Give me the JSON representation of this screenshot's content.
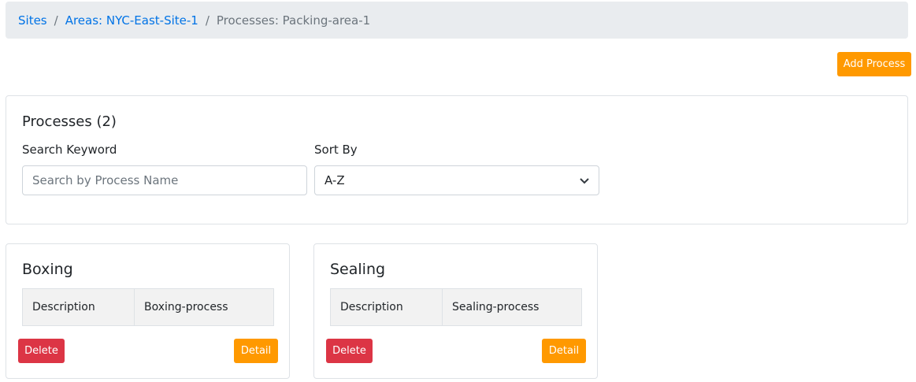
{
  "breadcrumb": {
    "items": [
      "Sites",
      "Areas: NYC-East-Site-1"
    ],
    "current": "Processes: Packing-area-1",
    "separator": "/"
  },
  "toolbar": {
    "add_label": "Add Process"
  },
  "filters": {
    "title": "Processes (2)",
    "search_label": "Search Keyword",
    "search_placeholder": "Search by Process Name",
    "search_value": "",
    "sort_label": "Sort By",
    "sort_value": "A-Z"
  },
  "processes": [
    {
      "name": "Boxing",
      "field": "Description",
      "value": "Boxing-process",
      "delete": "Delete",
      "detail": "Detail"
    },
    {
      "name": "Sealing",
      "field": "Description",
      "value": "Sealing-process",
      "delete": "Delete",
      "detail": "Detail"
    }
  ],
  "colors": {
    "accent": "#ff9900",
    "danger": "#dc3545",
    "link": "#0073e6"
  }
}
